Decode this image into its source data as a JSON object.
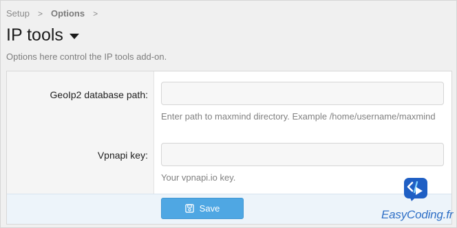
{
  "breadcrumb": {
    "items": [
      {
        "label": "Setup"
      },
      {
        "label": "Options"
      }
    ],
    "separator": ">"
  },
  "page": {
    "title": "IP tools",
    "description": "Options here control the IP tools add-on."
  },
  "form": {
    "geoip": {
      "label": "GeoIp2 database path:",
      "value": "",
      "hint": "Enter path to maxmind directory. Example /home/username/maxmind"
    },
    "vpnapi": {
      "label": "Vpnapi key:",
      "value": "",
      "hint": "Your vpnapi.io key."
    }
  },
  "footer": {
    "save_label": "Save",
    "save_icon": "save-icon"
  },
  "watermark": {
    "text": "EasyCoding.fr"
  },
  "colors": {
    "accent": "#4fa7e3",
    "footer_bg": "#edf4fa",
    "watermark": "#2e6fc6"
  }
}
